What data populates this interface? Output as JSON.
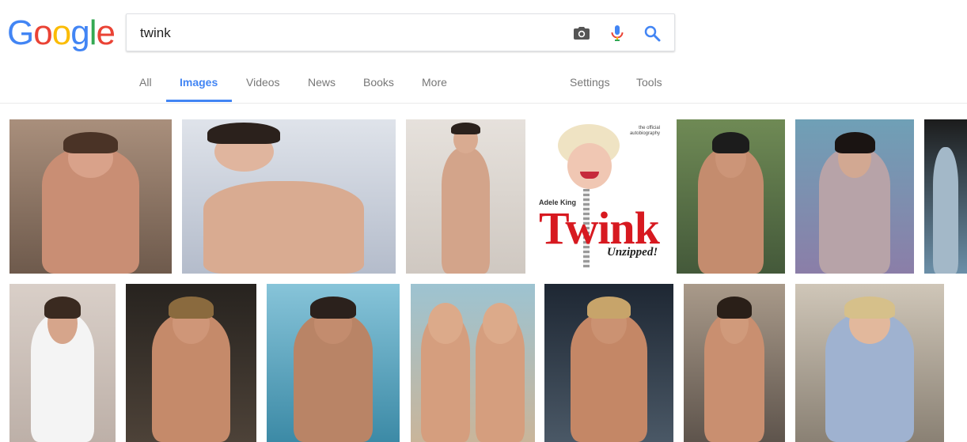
{
  "search": {
    "query": "twink"
  },
  "logo": {
    "letters": [
      "G",
      "o",
      "o",
      "g",
      "l",
      "e"
    ],
    "colors": [
      "#4285f4",
      "#ea4335",
      "#fbbc05",
      "#4285f4",
      "#34a853",
      "#ea4335"
    ]
  },
  "icons": {
    "camera": "camera-icon",
    "mic": "microphone-icon",
    "search": "search-icon"
  },
  "tabs": [
    {
      "label": "All",
      "active": false
    },
    {
      "label": "Images",
      "active": true
    },
    {
      "label": "Videos",
      "active": false
    },
    {
      "label": "News",
      "active": false
    },
    {
      "label": "Books",
      "active": false
    },
    {
      "label": "More",
      "active": false
    }
  ],
  "tools": {
    "settings": "Settings",
    "tools": "Tools"
  },
  "colors": {
    "accent": "#4285f4",
    "tab_inactive": "#777777"
  },
  "book_cover": {
    "title": "Twink",
    "subtitle": "Unzipped!",
    "author": "Adele King",
    "tagline": "the official autobiography"
  }
}
